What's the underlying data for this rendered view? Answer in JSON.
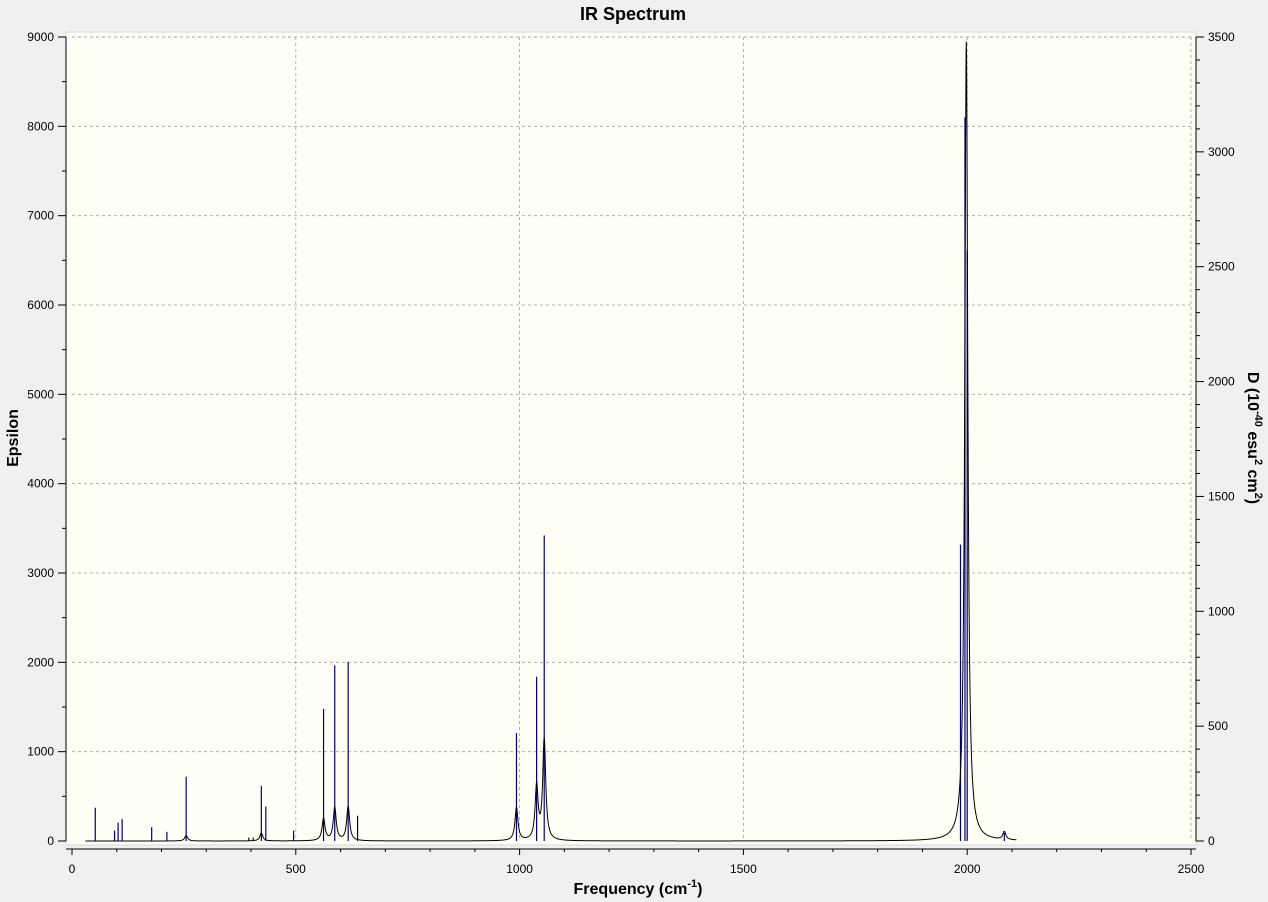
{
  "chart_data": {
    "type": "line",
    "title": "IR Spectrum",
    "xlabel": {
      "main": "Frequency (cm",
      "sup": "-1",
      "tail": ")"
    },
    "ylabel_left": "Epsilon",
    "ylabel_right": {
      "a": "D (10",
      "sup1": "-40",
      "b": " esu",
      "sup2": "2",
      "c": " cm",
      "sup3": "2",
      "d": ")"
    },
    "xlim": [
      0,
      2500
    ],
    "ylim_left": [
      0,
      9000
    ],
    "ylim_right": [
      0,
      3500
    ],
    "x_ticks": [
      0,
      500,
      1000,
      1500,
      2000,
      2500
    ],
    "y_ticks_left": [
      0,
      1000,
      2000,
      3000,
      4000,
      5000,
      6000,
      7000,
      8000,
      9000
    ],
    "y_ticks_right": [
      0,
      500,
      1000,
      1500,
      2000,
      2500,
      3000,
      3500
    ],
    "grid": true,
    "colors": {
      "plot_bg": "#fffff5",
      "spectrum": "#000000",
      "sticks": "#000080",
      "grid": "#a0a0a0",
      "frame": "#f0f0f0"
    },
    "series": [
      {
        "kind": "stick_intensities",
        "axis": "right",
        "peaks": [
          {
            "x": 52,
            "y": 145
          },
          {
            "x": 95,
            "y": 45
          },
          {
            "x": 103,
            "y": 80
          },
          {
            "x": 112,
            "y": 95
          },
          {
            "x": 178,
            "y": 60
          },
          {
            "x": 212,
            "y": 40
          },
          {
            "x": 255,
            "y": 280
          },
          {
            "x": 395,
            "y": 15
          },
          {
            "x": 405,
            "y": 15
          },
          {
            "x": 423,
            "y": 240
          },
          {
            "x": 433,
            "y": 150
          },
          {
            "x": 495,
            "y": 45
          },
          {
            "x": 562,
            "y": 575
          },
          {
            "x": 587,
            "y": 765
          },
          {
            "x": 617,
            "y": 780
          },
          {
            "x": 638,
            "y": 110
          },
          {
            "x": 993,
            "y": 470
          },
          {
            "x": 1038,
            "y": 715
          },
          {
            "x": 1055,
            "y": 1330
          },
          {
            "x": 1985,
            "y": 1290
          },
          {
            "x": 1995,
            "y": 3150
          },
          {
            "x": 2000,
            "y": 2570
          },
          {
            "x": 2083,
            "y": 35
          }
        ]
      },
      {
        "kind": "broadened_spectrum",
        "axis": "left",
        "x_range": [
          30,
          2110
        ],
        "peak_maxima": [
          {
            "x": 255,
            "y": 60
          },
          {
            "x": 423,
            "y": 90
          },
          {
            "x": 562,
            "y": 260
          },
          {
            "x": 587,
            "y": 380
          },
          {
            "x": 617,
            "y": 390
          },
          {
            "x": 993,
            "y": 380
          },
          {
            "x": 1038,
            "y": 660
          },
          {
            "x": 1055,
            "y": 1160
          },
          {
            "x": 1998,
            "y": 8950
          },
          {
            "x": 2083,
            "y": 110
          }
        ]
      }
    ]
  }
}
